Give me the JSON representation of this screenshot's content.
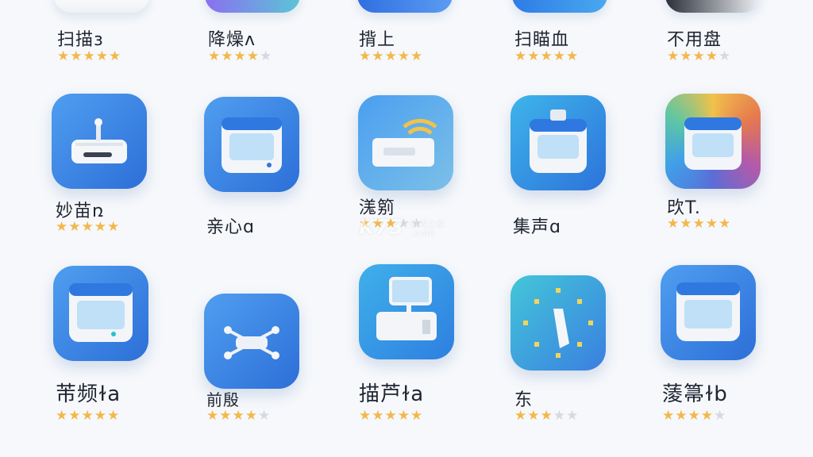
{
  "colors": {
    "star_on": "#f2b84b",
    "star_off": "#d6d9de",
    "background": "#f6f8fb"
  },
  "top_row": [
    {
      "label": "扫描ɜ",
      "rating": 4.5,
      "icon": "app-icon-partial-white"
    },
    {
      "label": "降燥ʌ",
      "rating": 4,
      "icon": "app-icon-partial-purple"
    },
    {
      "label": "揹上",
      "rating": 4.5,
      "icon": "app-icon-partial-blue"
    },
    {
      "label": "扫瞄血",
      "rating": 4.5,
      "icon": "app-icon-partial-blue"
    },
    {
      "label": "不用盘",
      "rating": 4,
      "icon": "app-icon-partial-dark"
    }
  ],
  "mid_row": [
    {
      "label": "妙苗ռ",
      "rating": 4.5,
      "icon": "router-icon"
    },
    {
      "label": "亲心ɑ",
      "rating": null,
      "icon": "scanner-device-icon"
    },
    {
      "label": "溬䇷",
      "rating": 3,
      "icon": "wifi-router-icon"
    },
    {
      "label": "集声ɑ",
      "rating": null,
      "icon": "scanner-device-icon"
    },
    {
      "label": "㰝T.",
      "rating": 5,
      "icon": "scanner-device-icon"
    }
  ],
  "bottom_row": [
    {
      "label": "芾频ɫa",
      "rating": 4.5,
      "icon": "scanner-device-icon"
    },
    {
      "label": "前殷",
      "rating": 3.5,
      "icon": "drone-icon"
    },
    {
      "label": "描芦ɫa",
      "rating": 4.5,
      "icon": "monitor-printer-icon"
    },
    {
      "label": "东",
      "rating": 3,
      "icon": "sparkle-brush-icon"
    },
    {
      "label": "蔆箒ɫb",
      "rating": 4,
      "icon": "scanner-device-icon"
    }
  ],
  "watermark": {
    "logo": "K73",
    "sub": "游戏之家",
    "domain": ".com"
  }
}
